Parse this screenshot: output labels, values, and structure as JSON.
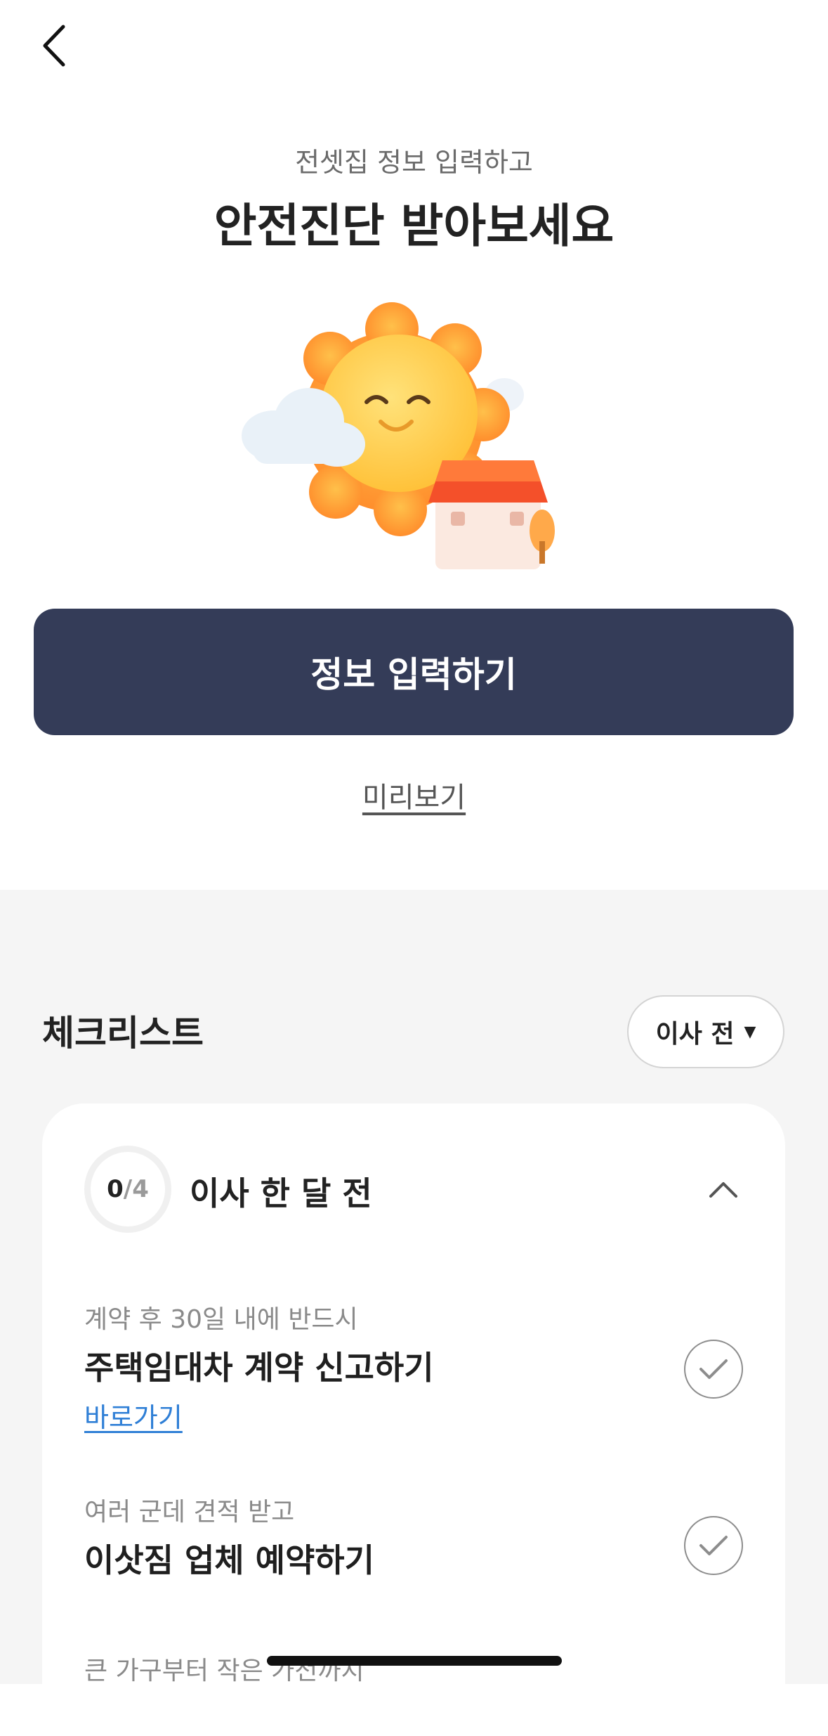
{
  "header": {
    "back_icon": "chevron-left-icon"
  },
  "hero": {
    "subtitle": "전셋집 정보 입력하고",
    "title": "안전진단 받아보세요",
    "illustration": "sun-house-illustration",
    "primary_button": "정보 입력하기",
    "preview_link": "미리보기"
  },
  "checklist": {
    "title": "체크리스트",
    "stage_dropdown": {
      "label": "이사 전",
      "caret": "▼"
    },
    "section": {
      "progress_done": "0",
      "progress_total": "/4",
      "title": "이사 한 달 전",
      "collapse_icon": "chevron-up-icon",
      "items": [
        {
          "sub": "계약 후 30일 내에 반드시",
          "title": "주택임대차 계약 신고하기",
          "link": "바로가기"
        },
        {
          "sub": "여러 군데 견적 받고",
          "title": "이삿짐 업체 예약하기"
        },
        {
          "sub": "큰 가구부터 작은 가전까지"
        }
      ]
    }
  },
  "colors": {
    "primary": "#343c58",
    "link": "#2f7fd6",
    "background_section": "#f5f5f5"
  }
}
